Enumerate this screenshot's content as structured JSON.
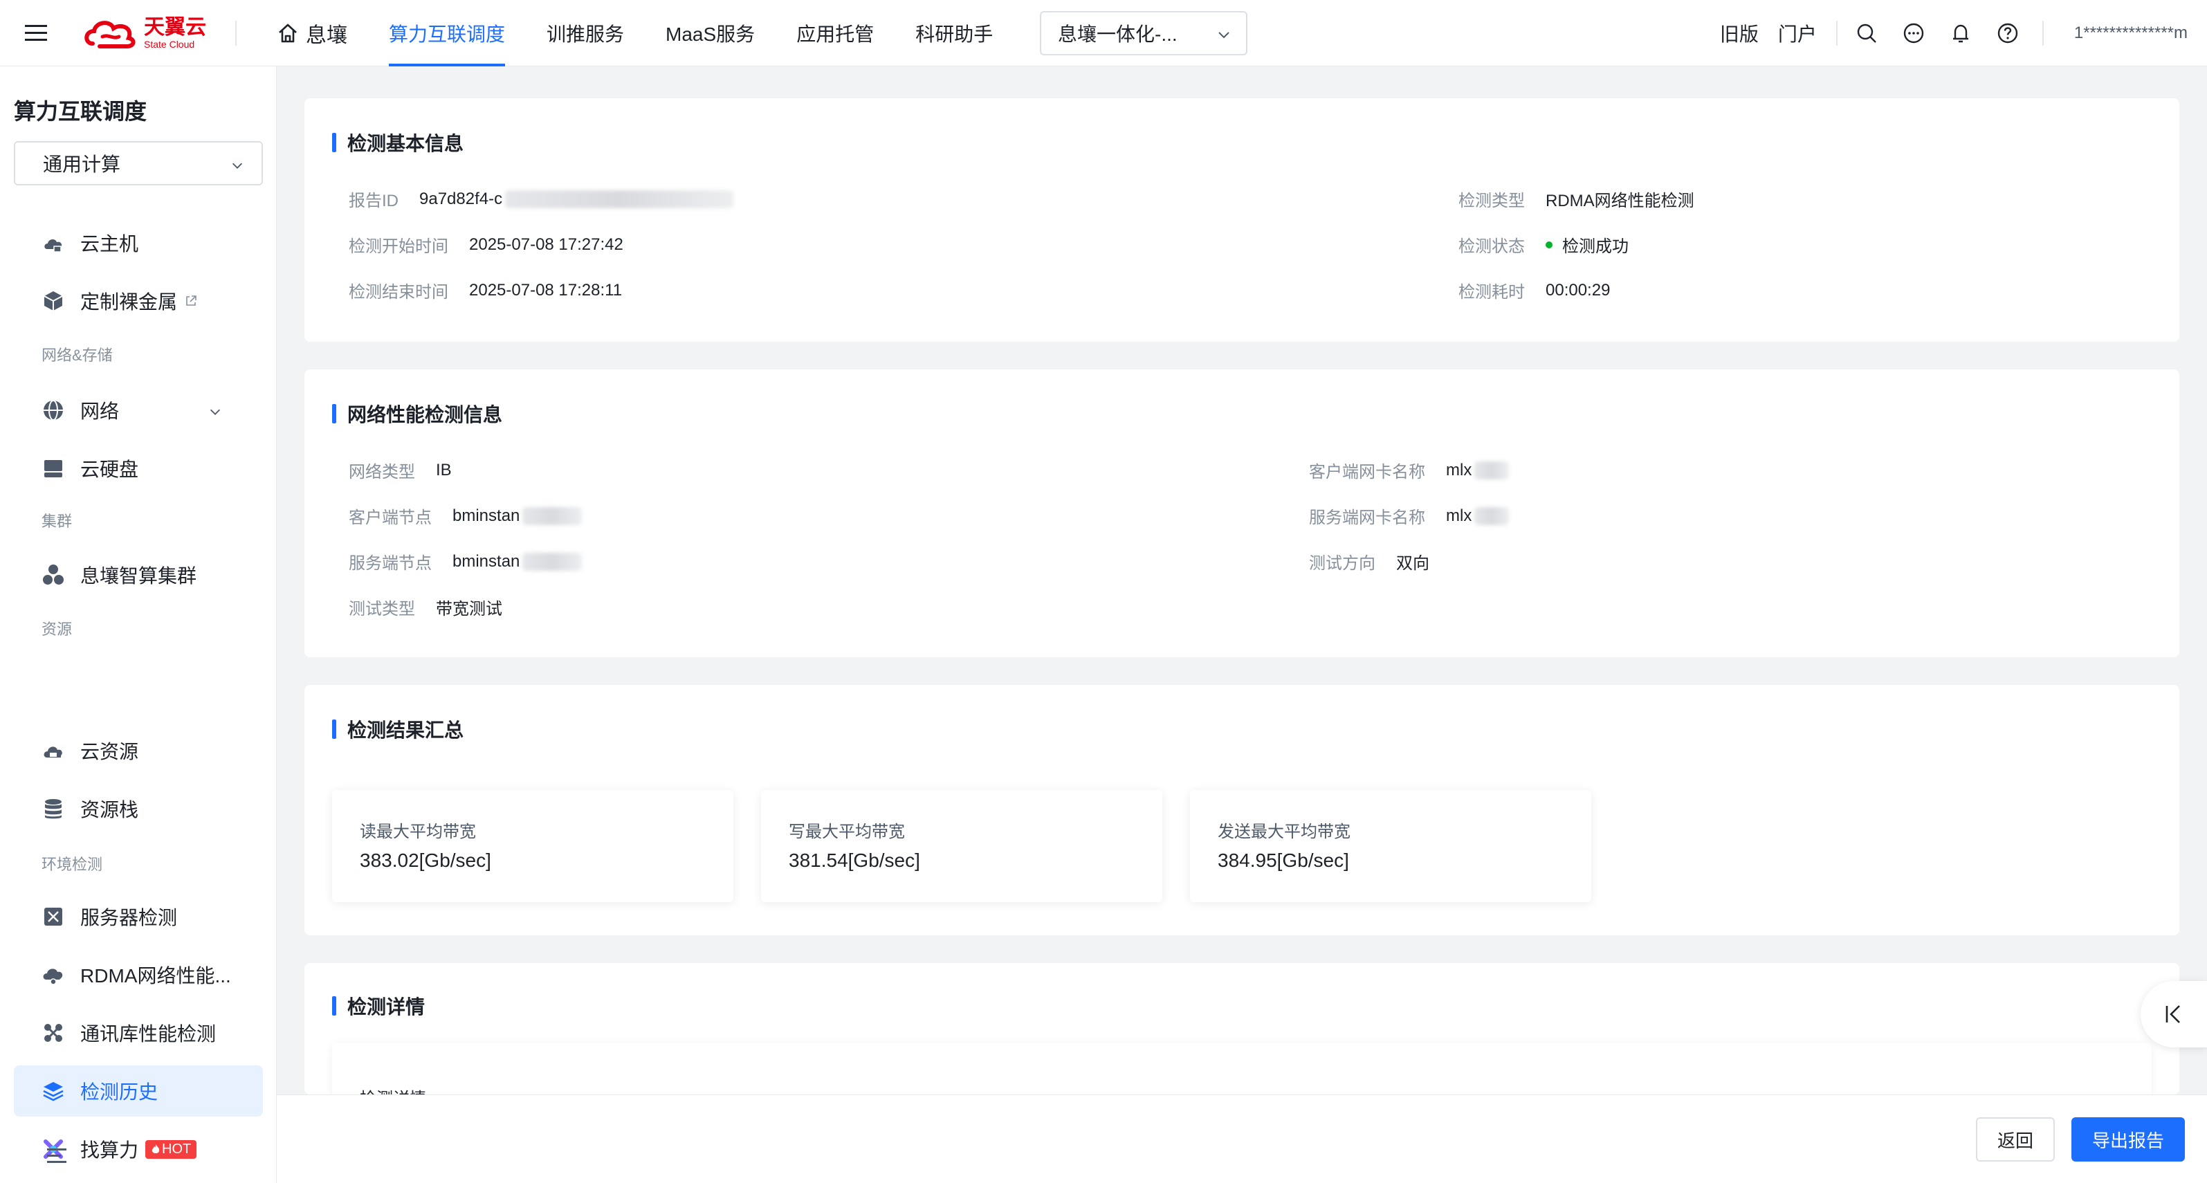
{
  "brand": {
    "name_cn": "天翼云",
    "name_en": "State Cloud",
    "color": "#e60012"
  },
  "accent": "#1c6eff",
  "nav": {
    "home": "息壤",
    "items": [
      "算力互联调度",
      "训推服务",
      "MaaS服务",
      "应用托管",
      "科研助手"
    ],
    "active": 0,
    "select": "息壤一体化-..."
  },
  "top_right": {
    "old_version": "旧版",
    "portal": "门户",
    "user": "1**************m"
  },
  "sidebar": {
    "title": "算力互联调度",
    "select": "通用计算",
    "items": {
      "vm": "云主机",
      "baremetal": "定制裸金属",
      "group_net": "网络&存储",
      "network": "网络",
      "disk": "云硬盘",
      "group_cluster": "集群",
      "cluster": "息壤智算集群",
      "group_res": "资源",
      "cloud_res": "云资源",
      "res_stack": "资源栈",
      "group_env": "环境检测",
      "server_check": "服务器检测",
      "rdma_check": "RDMA网络性能...",
      "comm_check": "通讯库性能检测",
      "history": "检测历史",
      "find": "找算力",
      "hot": "HOT"
    }
  },
  "basic": {
    "title": "检测基本信息",
    "report_id_label": "报告ID",
    "report_id": "9a7d82f4-c",
    "start_label": "检测开始时间",
    "start": "2025-07-08 17:27:42",
    "end_label": "检测结束时间",
    "end": "2025-07-08 17:28:11",
    "type_label": "检测类型",
    "type": "RDMA网络性能检测",
    "status_label": "检测状态",
    "status": "检测成功",
    "status_color": "#00b42a",
    "duration_label": "检测耗时",
    "duration": "00:00:29"
  },
  "network": {
    "title": "网络性能检测信息",
    "net_type_label": "网络类型",
    "net_type": "IB",
    "client_node_label": "客户端节点",
    "client_node": "bminstan",
    "server_node_label": "服务端节点",
    "server_node": "bminstan",
    "test_type_label": "测试类型",
    "test_type": "带宽测试",
    "client_nic_label": "客户端网卡名称",
    "client_nic": "mlx",
    "server_nic_label": "服务端网卡名称",
    "server_nic": "mlx",
    "direction_label": "测试方向",
    "direction": "双向"
  },
  "summary": {
    "title": "检测结果汇总",
    "stats": [
      {
        "label": "读最大平均带宽",
        "value": "383.02[Gb/sec]"
      },
      {
        "label": "写最大平均带宽",
        "value": "381.54[Gb/sec]"
      },
      {
        "label": "发送最大平均带宽",
        "value": "384.95[Gb/sec]"
      }
    ]
  },
  "details": {
    "title": "检测详情",
    "inner_label": "检测详情"
  },
  "footer": {
    "back": "返回",
    "export": "导出报告"
  }
}
